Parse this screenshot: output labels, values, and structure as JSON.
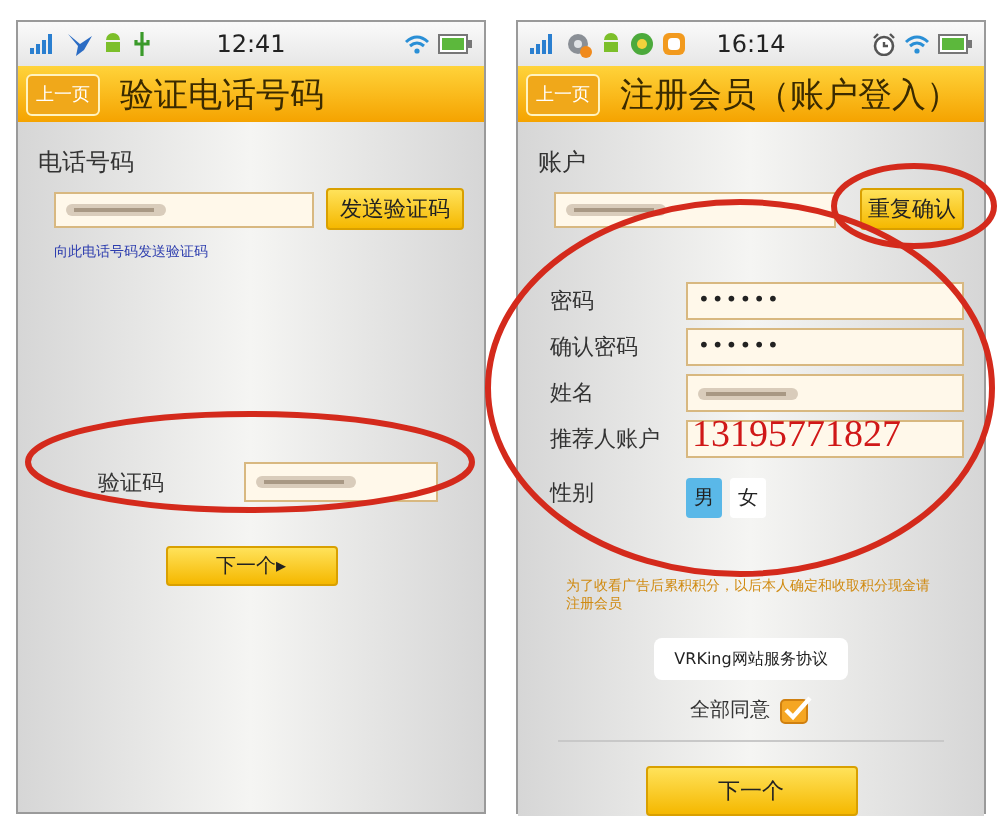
{
  "screens": [
    {
      "kind": "verify",
      "status_bar": {
        "time": "12:41"
      },
      "back_button": "上一页",
      "title": "验证电话号码",
      "phone_label": "电话号码",
      "phone_field": {
        "obscured": true
      },
      "send_code_button": "发送验证码",
      "hint": "向此电话号码发送验证码",
      "code_label": "验证码",
      "code_field": {
        "obscured": true
      },
      "next_button": "下一个▸"
    },
    {
      "kind": "register",
      "status_bar": {
        "time": "16:14"
      },
      "back_button": "上一页",
      "title": "注册会员（账户登入）",
      "account_label": "账户",
      "account_field": {
        "obscured": true
      },
      "confirm_button": "重复确认",
      "form": [
        {
          "kind": "text",
          "label": "密码",
          "value": "••••••"
        },
        {
          "kind": "text",
          "label": "确认密码",
          "value": "••••••"
        },
        {
          "kind": "text",
          "label": "姓名",
          "obscured": true
        },
        {
          "kind": "note",
          "label": "推荐人账户",
          "note": "13195771827"
        },
        {
          "kind": "gender",
          "label": "性别",
          "options": [
            {
              "label": "男",
              "selected": true
            },
            {
              "label": "女",
              "selected": false
            }
          ]
        }
      ],
      "notice": "为了收看广告后累积积分，以后本人确定和收取积分现金请注册会员",
      "agreement_button": "VRKing网站服务协议",
      "agree_checkbox": {
        "label": "全部同意",
        "checked": true
      },
      "next_button": "下一个"
    }
  ]
}
